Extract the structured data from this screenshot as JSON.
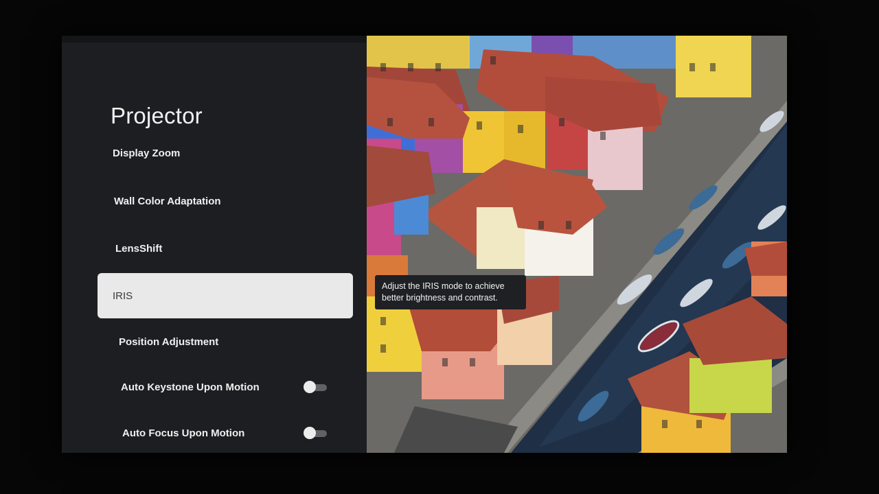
{
  "settings_panel": {
    "title": "Projector",
    "items": [
      {
        "label": "Display Zoom",
        "selected": false
      },
      {
        "label": "Wall Color Adaptation",
        "selected": false
      },
      {
        "label": "LensShift",
        "selected": false
      },
      {
        "label": "IRIS",
        "selected": true
      },
      {
        "label": "Position Adjustment",
        "selected": false
      },
      {
        "label": "Auto Keystone Upon Motion",
        "selected": false,
        "toggle": "off"
      },
      {
        "label": "Auto Focus Upon Motion",
        "selected": false,
        "toggle": "off"
      }
    ]
  },
  "tooltip": {
    "text": "Adjust the IRIS mode to achieve\nbetter brightness and contrast."
  },
  "colors": {
    "panel_bg": "#1c1e21",
    "selected_bg": "#e9e9e9",
    "toggle_knob": "#ececec",
    "toggle_track": "#5f6266"
  }
}
